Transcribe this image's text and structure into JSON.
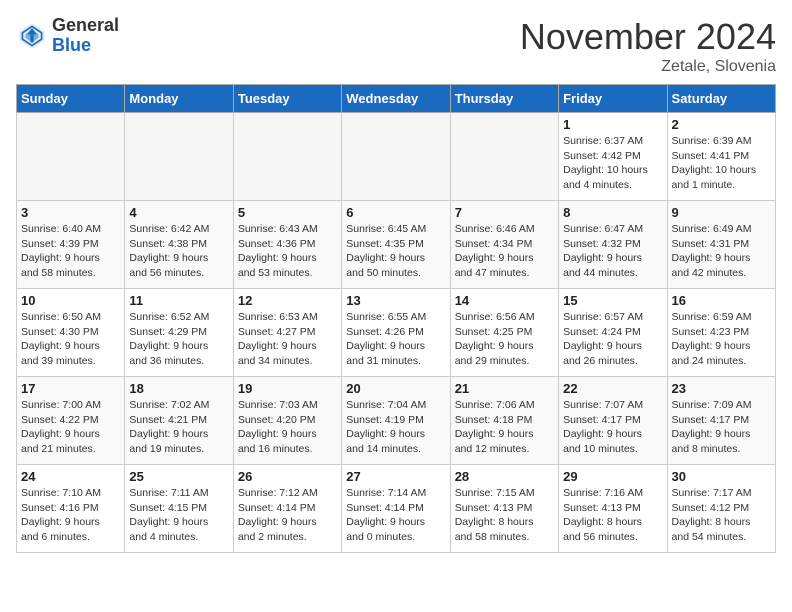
{
  "header": {
    "logo_general": "General",
    "logo_blue": "Blue",
    "month_title": "November 2024",
    "location": "Zetale, Slovenia"
  },
  "weekdays": [
    "Sunday",
    "Monday",
    "Tuesday",
    "Wednesday",
    "Thursday",
    "Friday",
    "Saturday"
  ],
  "weeks": [
    [
      {
        "day": "",
        "info": ""
      },
      {
        "day": "",
        "info": ""
      },
      {
        "day": "",
        "info": ""
      },
      {
        "day": "",
        "info": ""
      },
      {
        "day": "",
        "info": ""
      },
      {
        "day": "1",
        "info": "Sunrise: 6:37 AM\nSunset: 4:42 PM\nDaylight: 10 hours\nand 4 minutes."
      },
      {
        "day": "2",
        "info": "Sunrise: 6:39 AM\nSunset: 4:41 PM\nDaylight: 10 hours\nand 1 minute."
      }
    ],
    [
      {
        "day": "3",
        "info": "Sunrise: 6:40 AM\nSunset: 4:39 PM\nDaylight: 9 hours\nand 58 minutes."
      },
      {
        "day": "4",
        "info": "Sunrise: 6:42 AM\nSunset: 4:38 PM\nDaylight: 9 hours\nand 56 minutes."
      },
      {
        "day": "5",
        "info": "Sunrise: 6:43 AM\nSunset: 4:36 PM\nDaylight: 9 hours\nand 53 minutes."
      },
      {
        "day": "6",
        "info": "Sunrise: 6:45 AM\nSunset: 4:35 PM\nDaylight: 9 hours\nand 50 minutes."
      },
      {
        "day": "7",
        "info": "Sunrise: 6:46 AM\nSunset: 4:34 PM\nDaylight: 9 hours\nand 47 minutes."
      },
      {
        "day": "8",
        "info": "Sunrise: 6:47 AM\nSunset: 4:32 PM\nDaylight: 9 hours\nand 44 minutes."
      },
      {
        "day": "9",
        "info": "Sunrise: 6:49 AM\nSunset: 4:31 PM\nDaylight: 9 hours\nand 42 minutes."
      }
    ],
    [
      {
        "day": "10",
        "info": "Sunrise: 6:50 AM\nSunset: 4:30 PM\nDaylight: 9 hours\nand 39 minutes."
      },
      {
        "day": "11",
        "info": "Sunrise: 6:52 AM\nSunset: 4:29 PM\nDaylight: 9 hours\nand 36 minutes."
      },
      {
        "day": "12",
        "info": "Sunrise: 6:53 AM\nSunset: 4:27 PM\nDaylight: 9 hours\nand 34 minutes."
      },
      {
        "day": "13",
        "info": "Sunrise: 6:55 AM\nSunset: 4:26 PM\nDaylight: 9 hours\nand 31 minutes."
      },
      {
        "day": "14",
        "info": "Sunrise: 6:56 AM\nSunset: 4:25 PM\nDaylight: 9 hours\nand 29 minutes."
      },
      {
        "day": "15",
        "info": "Sunrise: 6:57 AM\nSunset: 4:24 PM\nDaylight: 9 hours\nand 26 minutes."
      },
      {
        "day": "16",
        "info": "Sunrise: 6:59 AM\nSunset: 4:23 PM\nDaylight: 9 hours\nand 24 minutes."
      }
    ],
    [
      {
        "day": "17",
        "info": "Sunrise: 7:00 AM\nSunset: 4:22 PM\nDaylight: 9 hours\nand 21 minutes."
      },
      {
        "day": "18",
        "info": "Sunrise: 7:02 AM\nSunset: 4:21 PM\nDaylight: 9 hours\nand 19 minutes."
      },
      {
        "day": "19",
        "info": "Sunrise: 7:03 AM\nSunset: 4:20 PM\nDaylight: 9 hours\nand 16 minutes."
      },
      {
        "day": "20",
        "info": "Sunrise: 7:04 AM\nSunset: 4:19 PM\nDaylight: 9 hours\nand 14 minutes."
      },
      {
        "day": "21",
        "info": "Sunrise: 7:06 AM\nSunset: 4:18 PM\nDaylight: 9 hours\nand 12 minutes."
      },
      {
        "day": "22",
        "info": "Sunrise: 7:07 AM\nSunset: 4:17 PM\nDaylight: 9 hours\nand 10 minutes."
      },
      {
        "day": "23",
        "info": "Sunrise: 7:09 AM\nSunset: 4:17 PM\nDaylight: 9 hours\nand 8 minutes."
      }
    ],
    [
      {
        "day": "24",
        "info": "Sunrise: 7:10 AM\nSunset: 4:16 PM\nDaylight: 9 hours\nand 6 minutes."
      },
      {
        "day": "25",
        "info": "Sunrise: 7:11 AM\nSunset: 4:15 PM\nDaylight: 9 hours\nand 4 minutes."
      },
      {
        "day": "26",
        "info": "Sunrise: 7:12 AM\nSunset: 4:14 PM\nDaylight: 9 hours\nand 2 minutes."
      },
      {
        "day": "27",
        "info": "Sunrise: 7:14 AM\nSunset: 4:14 PM\nDaylight: 9 hours\nand 0 minutes."
      },
      {
        "day": "28",
        "info": "Sunrise: 7:15 AM\nSunset: 4:13 PM\nDaylight: 8 hours\nand 58 minutes."
      },
      {
        "day": "29",
        "info": "Sunrise: 7:16 AM\nSunset: 4:13 PM\nDaylight: 8 hours\nand 56 minutes."
      },
      {
        "day": "30",
        "info": "Sunrise: 7:17 AM\nSunset: 4:12 PM\nDaylight: 8 hours\nand 54 minutes."
      }
    ]
  ]
}
